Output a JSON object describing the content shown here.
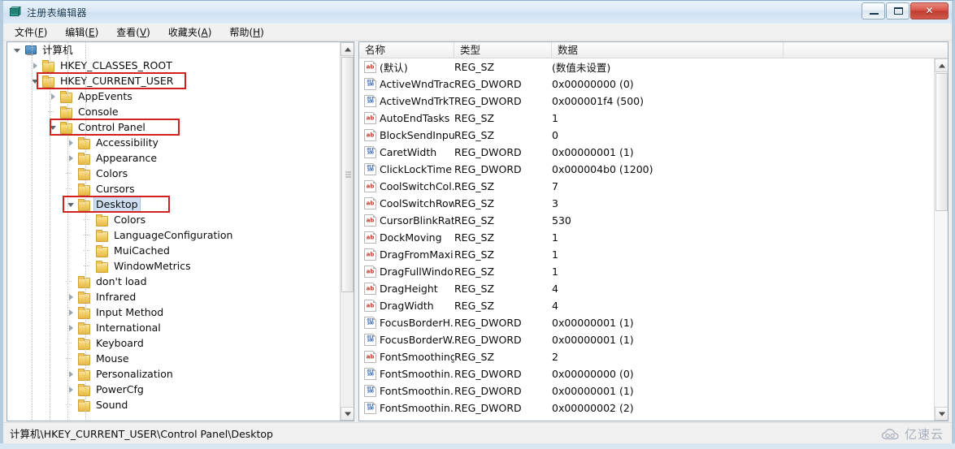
{
  "window": {
    "title": "注册表编辑器",
    "app_icon": "registry-editor-icon",
    "buttons": {
      "minimize": "最小化",
      "maximize": "最大化",
      "close": "✕"
    }
  },
  "menubar": {
    "items": [
      {
        "label": "文件(F)",
        "text": "文件(",
        "accel": "F",
        "tail": ")"
      },
      {
        "label": "编辑(E)",
        "text": "编辑(",
        "accel": "E",
        "tail": ")"
      },
      {
        "label": "查看(V)",
        "text": "查看(",
        "accel": "V",
        "tail": ")"
      },
      {
        "label": "收藏夹(A)",
        "text": "收藏夹(",
        "accel": "A",
        "tail": ")"
      },
      {
        "label": "帮助(H)",
        "text": "帮助(",
        "accel": "H",
        "tail": ")"
      }
    ]
  },
  "tree": {
    "items": [
      {
        "label": "计算机",
        "depth": 0,
        "twist": "open",
        "icon": "computer-icon",
        "selected": false
      },
      {
        "label": "HKEY_CLASSES_ROOT",
        "depth": 1,
        "twist": "closed",
        "icon": "folder-icon",
        "selected": false
      },
      {
        "label": "HKEY_CURRENT_USER",
        "depth": 1,
        "twist": "open",
        "icon": "folder-icon",
        "selected": false
      },
      {
        "label": "AppEvents",
        "depth": 2,
        "twist": "closed",
        "icon": "folder-icon",
        "selected": false
      },
      {
        "label": "Console",
        "depth": 2,
        "twist": "leaf",
        "icon": "folder-icon",
        "selected": false
      },
      {
        "label": "Control Panel",
        "depth": 2,
        "twist": "open",
        "icon": "folder-icon",
        "selected": false
      },
      {
        "label": "Accessibility",
        "depth": 3,
        "twist": "closed",
        "icon": "folder-icon",
        "selected": false
      },
      {
        "label": "Appearance",
        "depth": 3,
        "twist": "closed",
        "icon": "folder-icon",
        "selected": false
      },
      {
        "label": "Colors",
        "depth": 3,
        "twist": "leaf",
        "icon": "folder-icon",
        "selected": false
      },
      {
        "label": "Cursors",
        "depth": 3,
        "twist": "leaf",
        "icon": "folder-icon",
        "selected": false
      },
      {
        "label": "Desktop",
        "depth": 3,
        "twist": "open",
        "icon": "folder-icon",
        "selected": true
      },
      {
        "label": "Colors",
        "depth": 4,
        "twist": "leaf",
        "icon": "folder-icon",
        "selected": false
      },
      {
        "label": "LanguageConfiguration",
        "depth": 4,
        "twist": "leaf",
        "icon": "folder-icon",
        "selected": false
      },
      {
        "label": "MuiCached",
        "depth": 4,
        "twist": "leaf",
        "icon": "folder-icon",
        "selected": false
      },
      {
        "label": "WindowMetrics",
        "depth": 4,
        "twist": "leaf",
        "icon": "folder-icon",
        "selected": false
      },
      {
        "label": "don't load",
        "depth": 3,
        "twist": "leaf",
        "icon": "folder-icon",
        "selected": false
      },
      {
        "label": "Infrared",
        "depth": 3,
        "twist": "closed",
        "icon": "folder-icon",
        "selected": false
      },
      {
        "label": "Input Method",
        "depth": 3,
        "twist": "closed",
        "icon": "folder-icon",
        "selected": false
      },
      {
        "label": "International",
        "depth": 3,
        "twist": "closed",
        "icon": "folder-icon",
        "selected": false
      },
      {
        "label": "Keyboard",
        "depth": 3,
        "twist": "leaf",
        "icon": "folder-icon",
        "selected": false
      },
      {
        "label": "Mouse",
        "depth": 3,
        "twist": "leaf",
        "icon": "folder-icon",
        "selected": false
      },
      {
        "label": "Personalization",
        "depth": 3,
        "twist": "closed",
        "icon": "folder-icon",
        "selected": false
      },
      {
        "label": "PowerCfg",
        "depth": 3,
        "twist": "closed",
        "icon": "folder-icon",
        "selected": false
      },
      {
        "label": "Sound",
        "depth": 3,
        "twist": "leaf",
        "icon": "folder-icon",
        "selected": false
      }
    ],
    "annotations": [
      {
        "name": "highlight-hkey-current-user",
        "target": "HKEY_CURRENT_USER",
        "color": "#d21f1f"
      },
      {
        "name": "highlight-control-panel",
        "target": "Control Panel",
        "color": "#d21f1f"
      },
      {
        "name": "highlight-desktop",
        "target": "Desktop",
        "color": "#d21f1f"
      }
    ]
  },
  "list": {
    "columns": [
      {
        "key": "name",
        "label": "名称"
      },
      {
        "key": "type",
        "label": "类型"
      },
      {
        "key": "data",
        "label": "数据"
      }
    ],
    "rows": [
      {
        "name": "(默认)",
        "type": "REG_SZ",
        "data": "(数值未设置)",
        "icon": "string-value-icon"
      },
      {
        "name": "ActiveWndTrac...",
        "type": "REG_DWORD",
        "data": "0x00000000 (0)",
        "icon": "dword-value-icon"
      },
      {
        "name": "ActiveWndTrkT...",
        "type": "REG_DWORD",
        "data": "0x000001f4 (500)",
        "icon": "dword-value-icon"
      },
      {
        "name": "AutoEndTasks",
        "type": "REG_SZ",
        "data": "1",
        "icon": "string-value-icon"
      },
      {
        "name": "BlockSendInpu...",
        "type": "REG_SZ",
        "data": "0",
        "icon": "string-value-icon"
      },
      {
        "name": "CaretWidth",
        "type": "REG_DWORD",
        "data": "0x00000001 (1)",
        "icon": "dword-value-icon"
      },
      {
        "name": "ClickLockTime",
        "type": "REG_DWORD",
        "data": "0x000004b0 (1200)",
        "icon": "dword-value-icon"
      },
      {
        "name": "CoolSwitchCol...",
        "type": "REG_SZ",
        "data": "7",
        "icon": "string-value-icon"
      },
      {
        "name": "CoolSwitchRows",
        "type": "REG_SZ",
        "data": "3",
        "icon": "string-value-icon"
      },
      {
        "name": "CursorBlinkRate",
        "type": "REG_SZ",
        "data": "530",
        "icon": "string-value-icon"
      },
      {
        "name": "DockMoving",
        "type": "REG_SZ",
        "data": "1",
        "icon": "string-value-icon"
      },
      {
        "name": "DragFromMaxi...",
        "type": "REG_SZ",
        "data": "1",
        "icon": "string-value-icon"
      },
      {
        "name": "DragFullWindo...",
        "type": "REG_SZ",
        "data": "1",
        "icon": "string-value-icon"
      },
      {
        "name": "DragHeight",
        "type": "REG_SZ",
        "data": "4",
        "icon": "string-value-icon"
      },
      {
        "name": "DragWidth",
        "type": "REG_SZ",
        "data": "4",
        "icon": "string-value-icon"
      },
      {
        "name": "FocusBorderH...",
        "type": "REG_DWORD",
        "data": "0x00000001 (1)",
        "icon": "dword-value-icon"
      },
      {
        "name": "FocusBorderW...",
        "type": "REG_DWORD",
        "data": "0x00000001 (1)",
        "icon": "dword-value-icon"
      },
      {
        "name": "FontSmoothing",
        "type": "REG_SZ",
        "data": "2",
        "icon": "string-value-icon"
      },
      {
        "name": "FontSmoothin...",
        "type": "REG_DWORD",
        "data": "0x00000000 (0)",
        "icon": "dword-value-icon"
      },
      {
        "name": "FontSmoothin...",
        "type": "REG_DWORD",
        "data": "0x00000001 (1)",
        "icon": "dword-value-icon"
      },
      {
        "name": "FontSmoothin...",
        "type": "REG_DWORD",
        "data": "0x00000002 (2)",
        "icon": "dword-value-icon"
      }
    ]
  },
  "statusbar": {
    "path": "计算机\\HKEY_CURRENT_USER\\Control Panel\\Desktop"
  },
  "watermark": {
    "text": "亿速云",
    "icon": "cloud-icon"
  },
  "colors": {
    "annotation_red": "#d21f1f",
    "selection_blue": "#cddff0",
    "titlebar_blue": "#cfe1f2",
    "string_icon_red": "#c0392b",
    "dword_icon_blue": "#2b5fa8"
  }
}
